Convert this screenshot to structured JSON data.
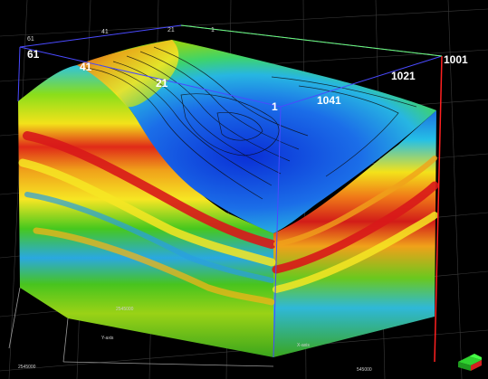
{
  "inline_labels": {
    "l1": "1",
    "l21": "21",
    "l41": "41",
    "l61": "61"
  },
  "xline_labels": {
    "l1001": "1001",
    "l1021": "1021",
    "l1041": "1041"
  },
  "top_grid_ticks": {
    "t1": "61",
    "t2": "41",
    "t3": "21",
    "t4": "1"
  },
  "axis_titles": {
    "y_axis": "Y-axis",
    "x_axis": "X-axis"
  },
  "coordinate_labels": {
    "y1": "2545000",
    "y2": "2545000",
    "x1": "545000"
  },
  "colors": {
    "background": "#000000",
    "grid": "#3a3a3a",
    "frame": "#4a4aff",
    "x_axis_line": "#ff2020",
    "top_axis_line": "#6cff6c",
    "surface_high": "#d62020",
    "surface_low": "#0a2fd6"
  },
  "icons": {
    "orientation": "orientation-cube-icon"
  }
}
